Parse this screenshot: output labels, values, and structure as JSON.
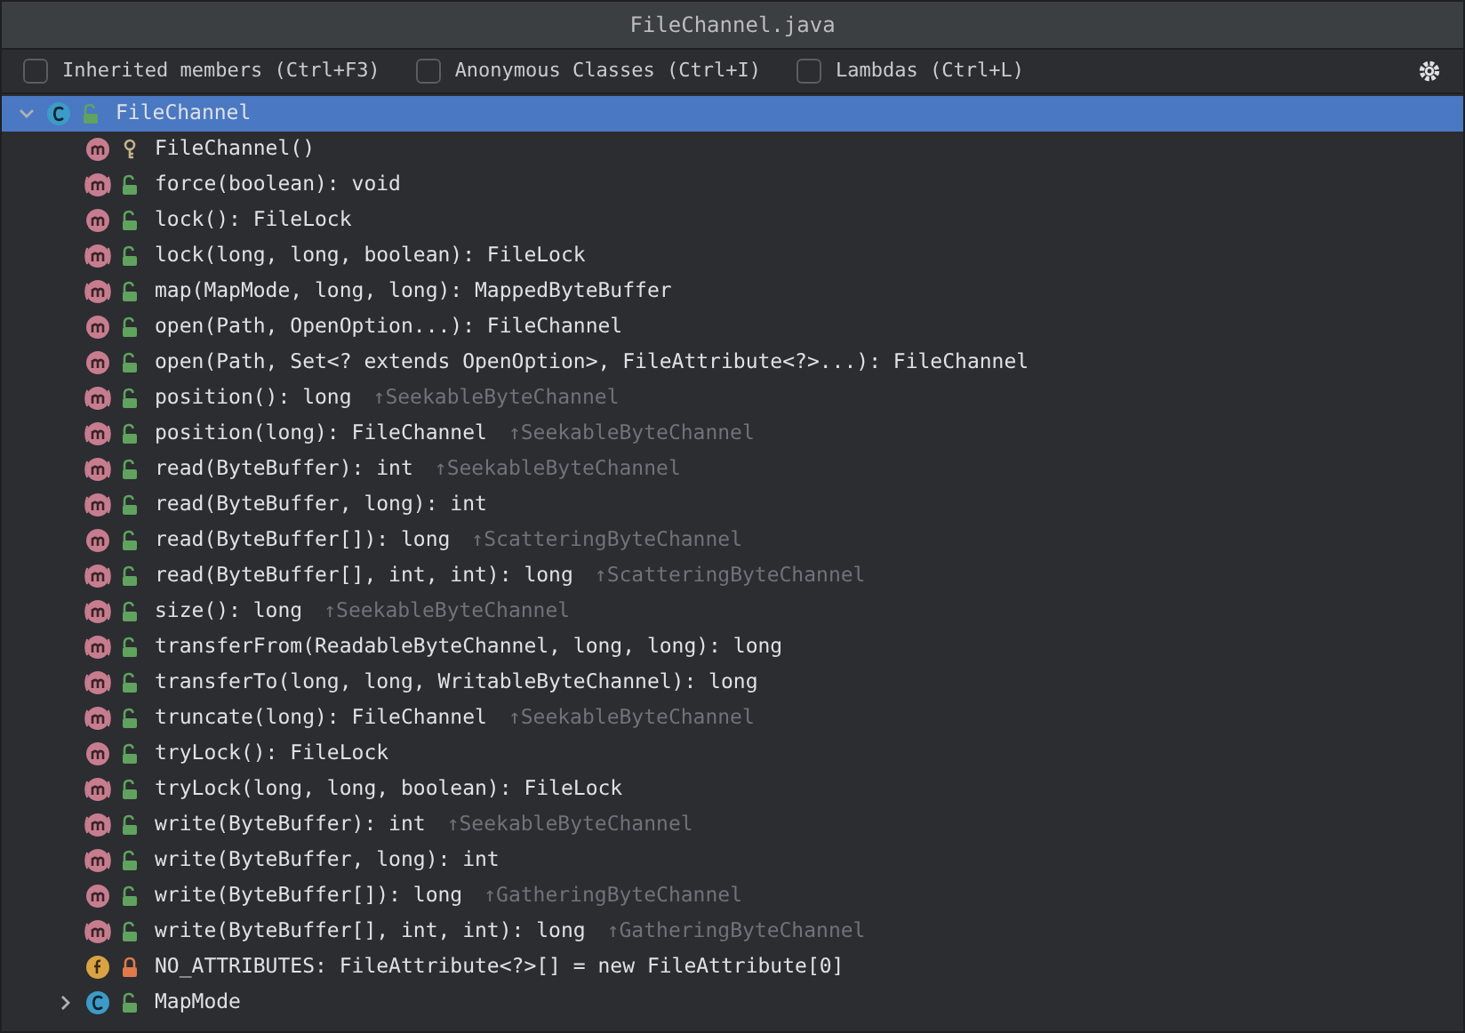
{
  "window": {
    "title": "FileChannel.java"
  },
  "filters": [
    {
      "label": "Inherited members (Ctrl+F3)",
      "checked": false
    },
    {
      "label": "Anonymous Classes (Ctrl+I)",
      "checked": false
    },
    {
      "label": "Lambdas (Ctrl+L)",
      "checked": false
    }
  ],
  "tree": [
    {
      "kind": "class",
      "access": {
        "kind": "public"
      },
      "name": "FileChannel",
      "expanded": true,
      "selected": true,
      "children": [
        {
          "kind": "method",
          "access": {
            "kind": "protected"
          },
          "name": "FileChannel()",
          "selected": false
        },
        {
          "kind": "abstract",
          "access": {
            "kind": "public"
          },
          "name": "force(boolean): void",
          "selected": false
        },
        {
          "kind": "method",
          "access": {
            "kind": "public"
          },
          "name": "lock(): FileLock",
          "selected": false
        },
        {
          "kind": "abstract",
          "access": {
            "kind": "public"
          },
          "name": "lock(long, long, boolean): FileLock",
          "selected": false
        },
        {
          "kind": "abstract",
          "access": {
            "kind": "public"
          },
          "name": "map(MapMode, long, long): MappedByteBuffer",
          "selected": false
        },
        {
          "kind": "method",
          "access": {
            "kind": "public"
          },
          "name": "open(Path, OpenOption...): FileChannel",
          "selected": false
        },
        {
          "kind": "method",
          "access": {
            "kind": "public"
          },
          "name": "open(Path, Set<? extends OpenOption>, FileAttribute<?>...): FileChannel",
          "selected": false
        },
        {
          "kind": "abstract",
          "access": {
            "kind": "public"
          },
          "name": "position(): long",
          "inherited": "↑SeekableByteChannel",
          "selected": false
        },
        {
          "kind": "abstract",
          "access": {
            "kind": "public"
          },
          "name": "position(long): FileChannel",
          "inherited": "↑SeekableByteChannel",
          "selected": false
        },
        {
          "kind": "abstract",
          "access": {
            "kind": "public"
          },
          "name": "read(ByteBuffer): int",
          "inherited": "↑SeekableByteChannel",
          "selected": false
        },
        {
          "kind": "abstract",
          "access": {
            "kind": "public"
          },
          "name": "read(ByteBuffer, long): int",
          "selected": false
        },
        {
          "kind": "method",
          "access": {
            "kind": "public"
          },
          "name": "read(ByteBuffer[]): long",
          "inherited": "↑ScatteringByteChannel",
          "selected": false
        },
        {
          "kind": "abstract",
          "access": {
            "kind": "public"
          },
          "name": "read(ByteBuffer[], int, int): long",
          "inherited": "↑ScatteringByteChannel",
          "selected": false
        },
        {
          "kind": "abstract",
          "access": {
            "kind": "public"
          },
          "name": "size(): long",
          "inherited": "↑SeekableByteChannel",
          "selected": false
        },
        {
          "kind": "abstract",
          "access": {
            "kind": "public"
          },
          "name": "transferFrom(ReadableByteChannel, long, long): long",
          "selected": false
        },
        {
          "kind": "abstract",
          "access": {
            "kind": "public"
          },
          "name": "transferTo(long, long, WritableByteChannel): long",
          "selected": false
        },
        {
          "kind": "abstract",
          "access": {
            "kind": "public"
          },
          "name": "truncate(long): FileChannel",
          "inherited": "↑SeekableByteChannel",
          "selected": false
        },
        {
          "kind": "method",
          "access": {
            "kind": "public"
          },
          "name": "tryLock(): FileLock",
          "selected": false
        },
        {
          "kind": "abstract",
          "access": {
            "kind": "public"
          },
          "name": "tryLock(long, long, boolean): FileLock",
          "selected": false
        },
        {
          "kind": "abstract",
          "access": {
            "kind": "public"
          },
          "name": "write(ByteBuffer): int",
          "inherited": "↑SeekableByteChannel",
          "selected": false
        },
        {
          "kind": "abstract",
          "access": {
            "kind": "public"
          },
          "name": "write(ByteBuffer, long): int",
          "selected": false
        },
        {
          "kind": "method",
          "access": {
            "kind": "public"
          },
          "name": "write(ByteBuffer[]): long",
          "inherited": "↑GatheringByteChannel",
          "selected": false
        },
        {
          "kind": "abstract",
          "access": {
            "kind": "public"
          },
          "name": "write(ByteBuffer[], int, int): long",
          "inherited": "↑GatheringByteChannel",
          "selected": false
        },
        {
          "kind": "field",
          "access": {
            "kind": "private"
          },
          "name": "NO_ATTRIBUTES: FileAttribute<?>[] = new FileAttribute[0]",
          "selected": false
        },
        {
          "kind": "class",
          "access": {
            "kind": "public"
          },
          "name": "MapMode",
          "expanded": false,
          "selected": false
        }
      ]
    }
  ]
}
